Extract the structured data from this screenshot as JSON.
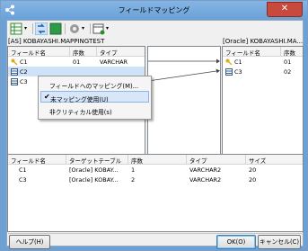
{
  "window": {
    "title": "フィールドマッピング",
    "close_glyph": "✕"
  },
  "left_panel": {
    "caption": "[AS] KOBAYASHI.MAPPINGTEST",
    "headers": [
      "フィールド名",
      "序数",
      "タイプ"
    ],
    "rows": [
      {
        "name": "C1",
        "ordinal": "01",
        "type": "VARCHAR",
        "icon": "key-icon"
      },
      {
        "name": "C2",
        "ordinal": "",
        "type": "",
        "icon": "column-icon"
      },
      {
        "name": "C3",
        "ordinal": "",
        "type": "",
        "icon": "column-icon"
      }
    ]
  },
  "right_panel": {
    "caption": "[Oracle] KOBAYASHI.MA...",
    "headers": [
      "フィールド名",
      "序数"
    ],
    "rows": [
      {
        "name": "C1",
        "ordinal": "01",
        "icon": "key-icon"
      },
      {
        "name": "C3",
        "ordinal": "02",
        "icon": "column-icon"
      }
    ]
  },
  "context_menu": {
    "items": [
      {
        "label": "フィールドへのマッピング(M)...",
        "checked": false
      },
      {
        "label": "未マッピング使用(U)",
        "checked": true
      },
      {
        "label": "非クリティカル使用(s)",
        "checked": false
      }
    ]
  },
  "bottom_table": {
    "headers": [
      "フィールド名",
      "ターゲットテーブル",
      "序数",
      "タイプ",
      "サイズ"
    ],
    "rows": [
      {
        "name": "C1",
        "target": "[Oracle] KOBAY...",
        "ordinal": "1",
        "type": "VARCHAR2",
        "size": "20"
      },
      {
        "name": "C3",
        "target": "[Oracle] KOBAY...",
        "ordinal": "2",
        "type": "VARCHAR2",
        "size": "20"
      }
    ]
  },
  "buttons": {
    "help": "ヘルプ(H)",
    "ok": "OK(O)",
    "cancel": "キャンセル(C)"
  },
  "colors": {
    "accent": "#3c7fb1",
    "selection": "#d7e6f8",
    "key": "#e0a81c"
  }
}
